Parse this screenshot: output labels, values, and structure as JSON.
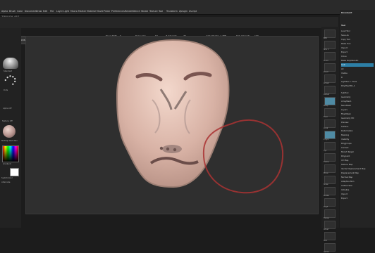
{
  "menu": [
    "Alpha",
    "Brush",
    "Color",
    "Document",
    "Draw",
    "Edit",
    "File",
    "Layer",
    "Light",
    "Macro",
    "Marker",
    "Material",
    "Movie",
    "Picker",
    "Preferences",
    "Render",
    "Stencil",
    "Stroke",
    "Texture",
    "Tool",
    "Transform",
    "Zplugin",
    "Zscript"
  ],
  "brand": "ZBRUSH 4R7",
  "toolbar": {
    "projection_master": "Projection Master",
    "lightbox": "LightBox",
    "quick_sketch": "Quick Sketch",
    "draw": "Draw",
    "move": "Move",
    "scale": "Scale",
    "rotate": "Rotate",
    "mrgb": "Mrgb",
    "rgb": "Rgb",
    "m": "M",
    "zadd": "Zadd",
    "zsub": "Zsub",
    "zcut": "Zcut",
    "focal_shift_label": "Focal Shift",
    "focal_shift_value": "0",
    "draw_size_label": "Draw Size",
    "draw_size_value": "64",
    "z_intensity_label": "Z Intensity",
    "z_intensity_value": "25",
    "dynamic": "Dynamic",
    "rgb_intensity_label": "Rgb Intensity",
    "rgb_intensity_value": "100",
    "active_points": "ActivePoints: 1,488",
    "total_points": "TotalPoints: 1,488",
    "progress_fill": 0.42,
    "slider_fill_draw": 0.55,
    "slider_fill_z": 0.25,
    "slider_fill_rgb": 1.0
  },
  "left_shelf": {
    "labels": [
      "Standard",
      "Dots",
      "Alpha Off",
      "Texture Off",
      "MatCap Red Wax",
      "Gradient",
      "SwitchColor",
      "Alternate"
    ],
    "color_top": "#7b0000",
    "swatch_color": "#ffffff"
  },
  "right_icons": {
    "labels": [
      "BPR",
      "SPix 3",
      "Scroll",
      "Zoom",
      "Actual",
      "AAHalf",
      "Persp",
      "Floor",
      "Local",
      "L.Sym",
      "Xyz",
      "Frame",
      "Move",
      "Scale",
      "Rotate",
      "PolyF",
      "Transp",
      "Ghost",
      "Solo",
      "Xpose"
    ]
  },
  "right_panel": {
    "title": "Document",
    "sections": [
      "Tool",
      "Load Tool",
      "Save As",
      "Copy Tool",
      "Paste Tool",
      "Import",
      "Export",
      "Clone",
      "Make PolyMesh3D",
      "GoZ",
      "All",
      "Visible",
      "R",
      "Lightbox > Tools",
      "PolyMesh3D_1",
      "SubTool",
      "Geometry",
      "ArrayMesh",
      "NanoMesh",
      "Layers",
      "FiberMesh",
      "Geometry HD",
      "Preview",
      "Surface",
      "Deformation",
      "Masking",
      "Visibility",
      "Polygroups",
      "Contact",
      "Morph Target",
      "Polypaint",
      "UV Map",
      "Texture Map",
      "Vector Displacement Map",
      "Displacement Map",
      "Normal Map",
      "Adaptive Skin",
      "Unified Skin",
      "Initialize",
      "Import",
      "Export"
    ],
    "accent": "#2d7fa6"
  },
  "viewport": {
    "background": "#2f2f2f",
    "model_color": "#e7c4b8",
    "brush_ring_color": "#a33"
  }
}
